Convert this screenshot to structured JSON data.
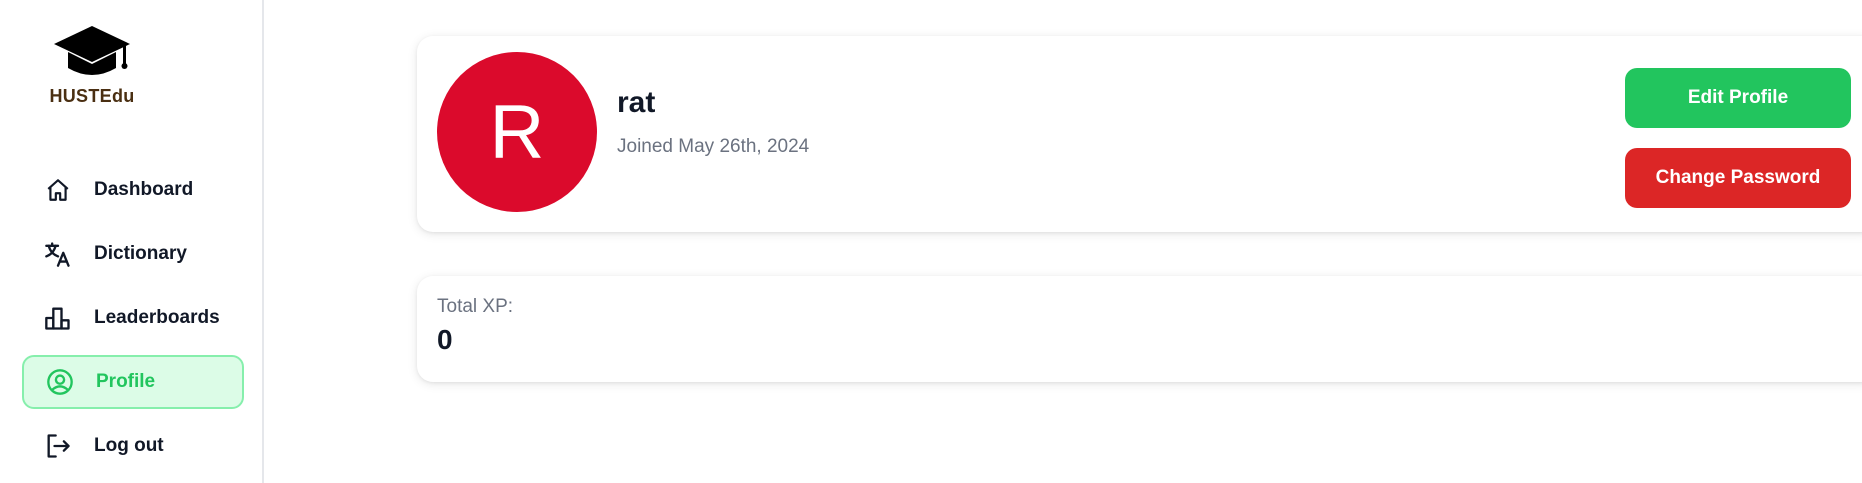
{
  "brand": {
    "name": "HUSTEdu",
    "logo_icon": "graduation-cap-icon",
    "text_color": "#4a2f12"
  },
  "sidebar": {
    "items": [
      {
        "label": "Dashboard",
        "icon": "home-icon",
        "active": false
      },
      {
        "label": "Dictionary",
        "icon": "translate-icon",
        "active": false
      },
      {
        "label": "Leaderboards",
        "icon": "bar-chart-icon",
        "active": false
      },
      {
        "label": "Profile",
        "icon": "user-circle-icon",
        "active": true
      },
      {
        "label": "Log out",
        "icon": "logout-icon",
        "active": false
      }
    ]
  },
  "profile": {
    "avatar_letter": "R",
    "avatar_color": "#db0a2c",
    "username": "rat",
    "joined": "Joined May 26th, 2024",
    "edit_button": "Edit Profile",
    "change_password_button": "Change Password"
  },
  "stats": {
    "xp_label": "Total XP:",
    "xp_value": "0"
  },
  "colors": {
    "accent_green": "#22c55e",
    "danger_red": "#dc2626",
    "active_bg": "#dcfce7"
  }
}
